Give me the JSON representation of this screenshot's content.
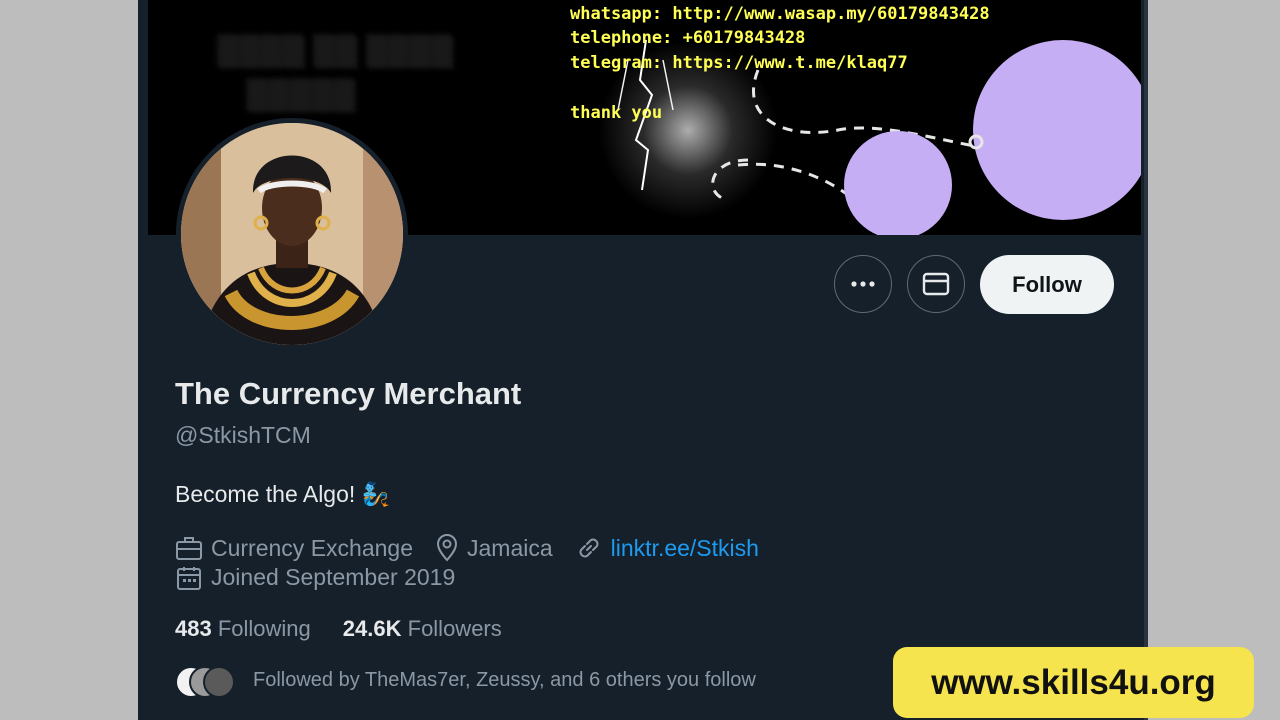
{
  "banner": {
    "lines": [
      "whatsapp: http://www.wasap.my/60179843428",
      "telephone: +60179843428",
      "telegram: https://www.t.me/klaq77",
      "thank you"
    ]
  },
  "profile": {
    "name": "The Currency Merchant",
    "handle": "@StkishTCM",
    "bio": "Become the Algo! 🧞",
    "category": "Currency Exchange",
    "location": "Jamaica",
    "website": "linktr.ee/Stkish",
    "joined": "Joined September 2019"
  },
  "actions": {
    "follow_label": "Follow"
  },
  "stats": {
    "following_count": "483",
    "following_label": "Following",
    "followers_count": "24.6K",
    "followers_label": "Followers"
  },
  "followed_by": "Followed by TheMas7er, Zeussy, and 6 others you follow",
  "watermark": "www.skills4u.org",
  "icons": {
    "more": "more-icon",
    "message": "message-icon",
    "briefcase": "briefcase-icon",
    "location": "location-pin-icon",
    "link": "link-icon",
    "calendar": "calendar-icon"
  },
  "colors": {
    "background": "#15202b",
    "text": "#e7e9ea",
    "muted": "#8b98a5",
    "link": "#1d9bf0",
    "banner_text": "#ffff55",
    "promo": "#f5e44e"
  }
}
